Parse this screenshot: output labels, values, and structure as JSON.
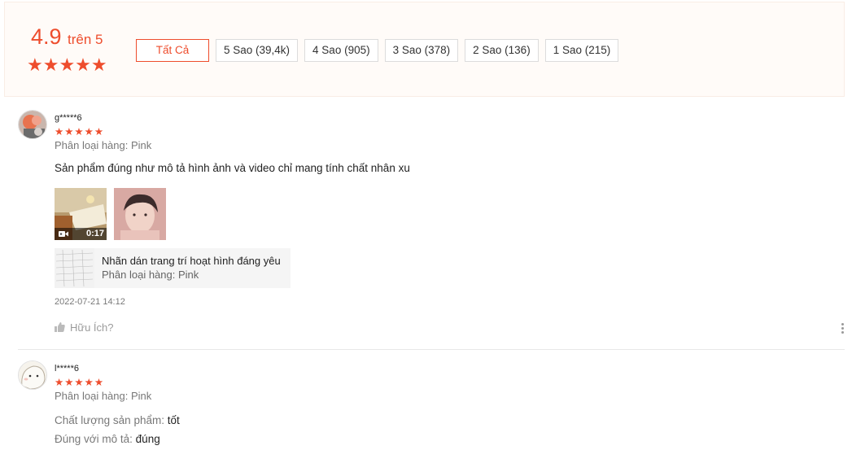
{
  "summary": {
    "score": "4.9",
    "score_suffix": "trên 5",
    "stars": "★★★★★"
  },
  "filters": [
    "Tất Cả",
    "5 Sao (39,4k)",
    "4 Sao (905)",
    "3 Sao (378)",
    "2 Sao (136)",
    "1 Sao (215)"
  ],
  "reviews": [
    {
      "username": "g*****6",
      "stars": "★★★★★",
      "variation": "Phân loại hàng: Pink",
      "content": "Sản phẩm đúng như mô tả hình ảnh và video chỉ mang tính chất nhân xu",
      "video_duration": "0:17",
      "product_name": "Nhãn dán trang trí hoạt hình đáng yêu",
      "product_variation": "Phân loại hàng: Pink",
      "time": "2022-07-21 14:12",
      "helpful_label": "Hữu Ích?"
    },
    {
      "username": "l*****6",
      "stars": "★★★★★",
      "variation": "Phân loại hàng: Pink",
      "attr1_label": "Chất lượng sản phẩm:",
      "attr1_value": "tốt",
      "attr2_label": "Đúng với mô tả:",
      "attr2_value": "đúng"
    }
  ],
  "colors": {
    "accent": "#ee4d2d",
    "summary_bg": "#fffbf8"
  }
}
